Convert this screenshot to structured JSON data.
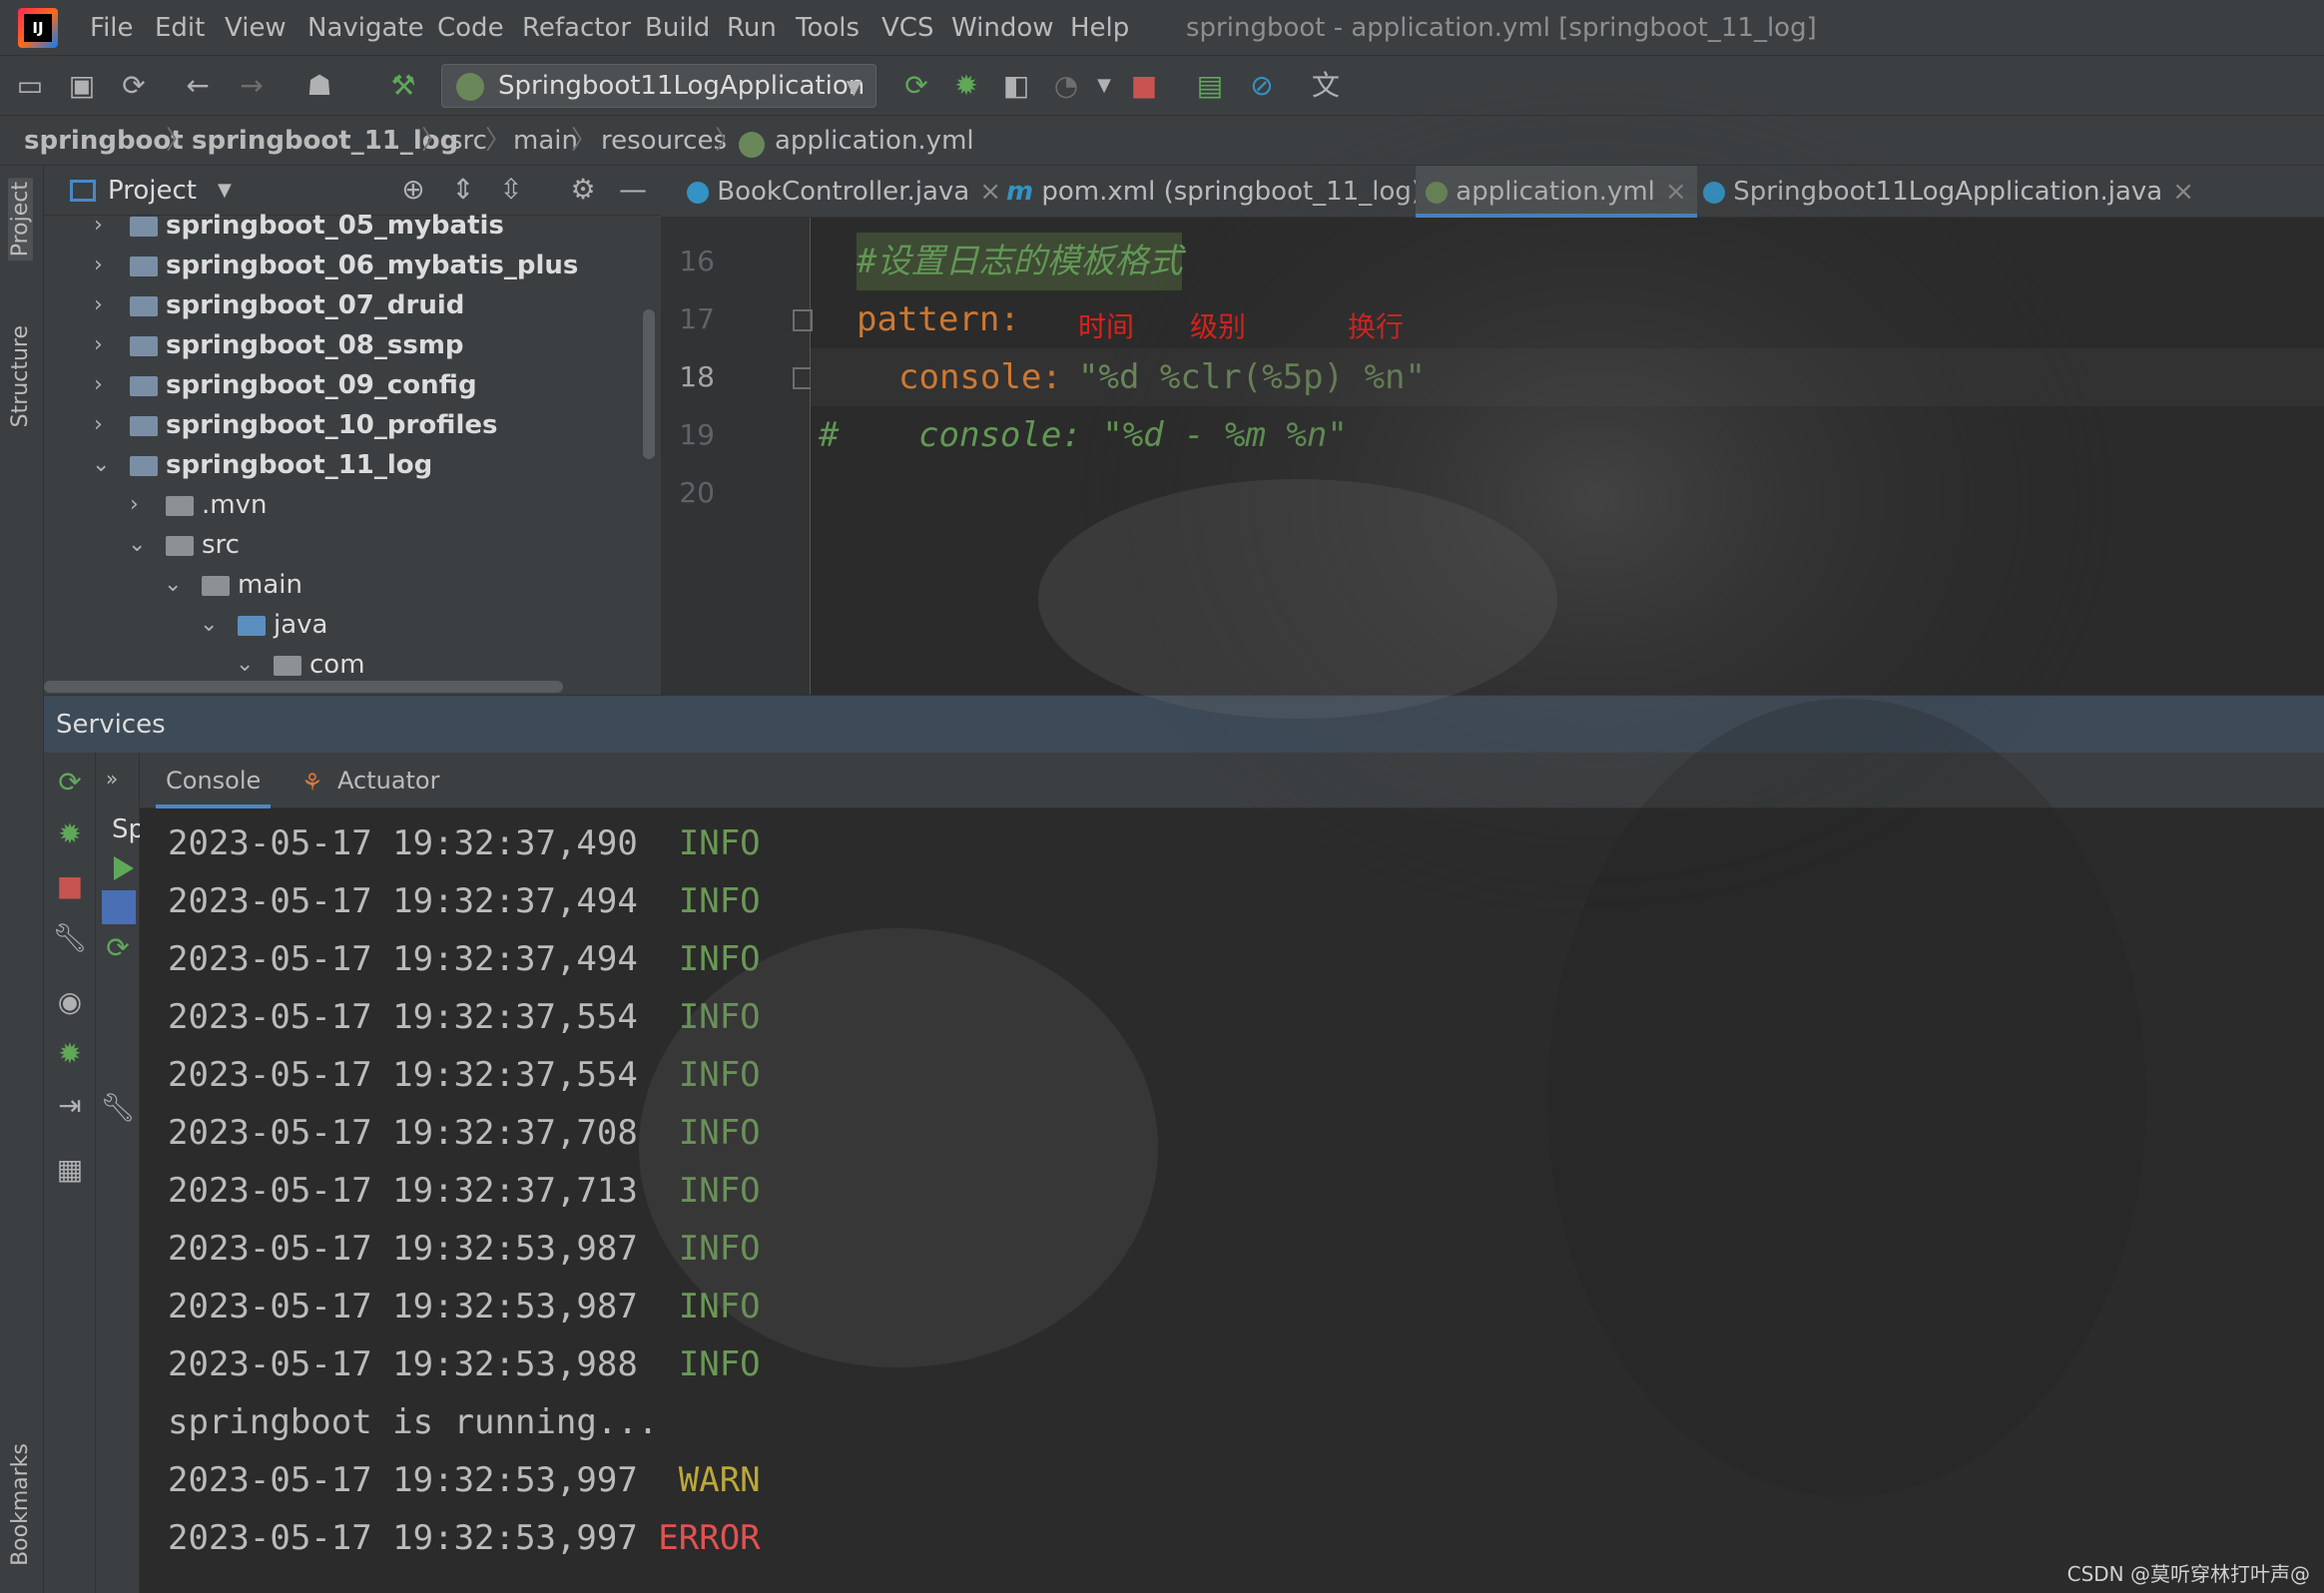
{
  "menu": {
    "items": [
      "File",
      "Edit",
      "View",
      "Navigate",
      "Code",
      "Refactor",
      "Build",
      "Run",
      "Tools",
      "VCS",
      "Window",
      "Help"
    ],
    "window_title": "springboot - application.yml [springboot_11_log]"
  },
  "toolbar": {
    "run_config": "Springboot11LogApplication"
  },
  "breadcrumb": [
    "springboot",
    "springboot_11_log",
    "src",
    "main",
    "resources",
    "application.yml"
  ],
  "left_stripe": {
    "project": "Project",
    "structure": "Structure",
    "bookmarks": "Bookmarks"
  },
  "project_panel": {
    "title": "Project",
    "tree": [
      {
        "label": "springboot_05_mybatis"
      },
      {
        "label": "springboot_06_mybatis_plus"
      },
      {
        "label": "springboot_07_druid"
      },
      {
        "label": "springboot_08_ssmp"
      },
      {
        "label": "springboot_09_config"
      },
      {
        "label": "springboot_10_profiles"
      },
      {
        "label": "springboot_11_log"
      },
      {
        "label": ".mvn"
      },
      {
        "label": "src"
      },
      {
        "label": "main"
      },
      {
        "label": "java"
      },
      {
        "label": "com"
      }
    ]
  },
  "editor": {
    "tabs": [
      "BookController.java",
      "pom.xml (springboot_11_log)",
      "application.yml",
      "Springboot11LogApplication.java"
    ],
    "active_tab": "application.yml",
    "line_numbers": [
      "16",
      "17",
      "18",
      "19",
      "20"
    ],
    "comment": "#设置日志的模板格式",
    "pattern_key": "pattern:",
    "console_key": "console:",
    "console_value": "\"%d %clr(%5p) %n\"",
    "commented_hash": "#",
    "commented_line": "console: \"%d - %m %n\"",
    "annotations": [
      "时间",
      "级别",
      "换行"
    ]
  },
  "services": {
    "title": "Services",
    "tabs": [
      "Console",
      "Actuator"
    ],
    "tree_label": "Sp",
    "console_lines": [
      {
        "ts": "2023-05-17 19:32:37,490",
        "level": " INFO"
      },
      {
        "ts": "2023-05-17 19:32:37,494",
        "level": " INFO"
      },
      {
        "ts": "2023-05-17 19:32:37,494",
        "level": " INFO"
      },
      {
        "ts": "2023-05-17 19:32:37,554",
        "level": " INFO"
      },
      {
        "ts": "2023-05-17 19:32:37,554",
        "level": " INFO"
      },
      {
        "ts": "2023-05-17 19:32:37,708",
        "level": " INFO"
      },
      {
        "ts": "2023-05-17 19:32:37,713",
        "level": " INFO"
      },
      {
        "ts": "2023-05-17 19:32:53,987",
        "level": " INFO"
      },
      {
        "ts": "2023-05-17 19:32:53,987",
        "level": " INFO"
      },
      {
        "ts": "2023-05-17 19:32:53,988",
        "level": " INFO"
      },
      {
        "ts": "springboot is running...",
        "level": ""
      },
      {
        "ts": "2023-05-17 19:32:53,997",
        "level": " WARN"
      },
      {
        "ts": "2023-05-17 19:32:53,997",
        "level": "ERROR"
      }
    ]
  },
  "watermark": "CSDN @莫听穿林打叶声@",
  "colors": {
    "info": "#6a9955",
    "warn": "#bba83a",
    "error": "#e05252",
    "keyword": "#cc7832",
    "string": "#6a8759",
    "annotation": "#e0201b"
  }
}
